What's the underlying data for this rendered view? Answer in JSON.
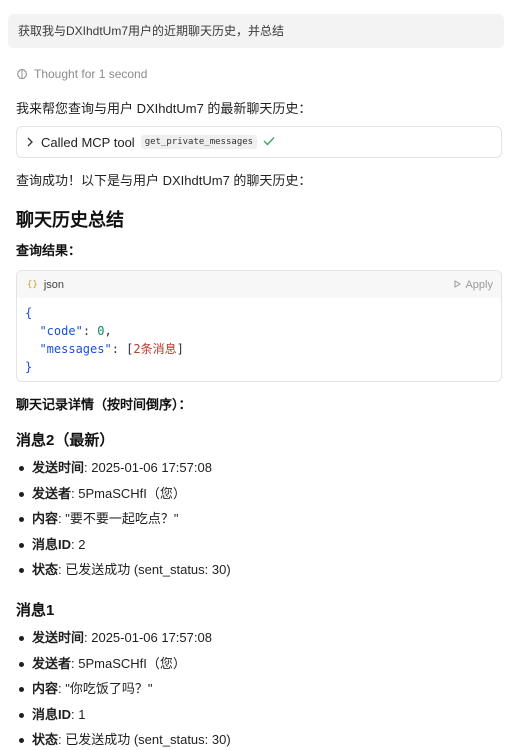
{
  "user_message": "获取我与DXIhdtUm7用户的近期聊天历史，并总结",
  "thought": {
    "label": "Thought for 1 second"
  },
  "intro": "我来帮您查询与用户 DXIhdtUm7 的最新聊天历史：",
  "tool_call": {
    "label": "Called MCP tool",
    "tool_name": "get_private_messages",
    "status_icon": "check-icon"
  },
  "result_intro": "查询成功！以下是与用户 DXIhdtUm7 的聊天历史：",
  "summary_title": "聊天历史总结",
  "query_result_label": "查询结果：",
  "code": {
    "language": "json",
    "apply_label": "Apply",
    "open_brace": "{",
    "close_brace": "}",
    "key_code": "\"code\"",
    "val_code": "0",
    "key_messages": "\"messages\"",
    "val_messages_open": "[",
    "val_messages_count": "2条消息",
    "val_messages_close": "]"
  },
  "details_label": "聊天记录详情（按时间倒序）：",
  "messages": [
    {
      "title": "消息2（最新）",
      "fields": [
        {
          "label": "发送时间",
          "value": ": 2025-01-06 17:57:08"
        },
        {
          "label": "发送者",
          "value": ": 5PmaSCHfI（您）"
        },
        {
          "label": "内容",
          "value": ": \"要不要一起吃点？\""
        },
        {
          "label": "消息ID",
          "value": ": 2"
        },
        {
          "label": "状态",
          "value": ": 已发送成功 (sent_status: 30)"
        }
      ]
    },
    {
      "title": "消息1",
      "fields": [
        {
          "label": "发送时间",
          "value": ": 2025-01-06 17:57:08"
        },
        {
          "label": "发送者",
          "value": ": 5PmaSCHfI（您）"
        },
        {
          "label": "内容",
          "value": ": \"你吃饭了吗？\""
        },
        {
          "label": "消息ID",
          "value": ": 1"
        },
        {
          "label": "状态",
          "value": ": 已发送成功 (sent_status: 30)"
        }
      ]
    }
  ]
}
